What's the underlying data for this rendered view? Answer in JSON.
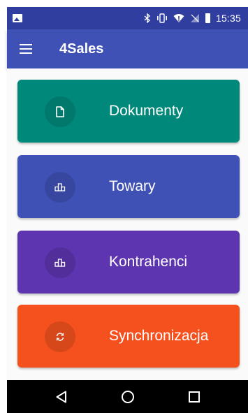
{
  "status_bar": {
    "time": "15:35",
    "icons": [
      "image-icon",
      "bluetooth-icon",
      "vibrate-icon",
      "wifi-icon",
      "no-signal-icon",
      "battery-icon"
    ]
  },
  "app_bar": {
    "title": "4Sales",
    "menu_icon": "hamburger-menu-icon"
  },
  "tiles": [
    {
      "label": "Dokumenty",
      "icon": "document-icon",
      "color": "#00897b"
    },
    {
      "label": "Towary",
      "icon": "boxes-icon",
      "color": "#3f51b5"
    },
    {
      "label": "Kontrahenci",
      "icon": "boxes-icon",
      "color": "#5e35b1"
    },
    {
      "label": "Synchronizacja",
      "icon": "sync-icon",
      "color": "#f4511e"
    }
  ],
  "nav_bar": {
    "buttons": [
      "back-icon",
      "home-icon",
      "recents-icon"
    ]
  },
  "colors": {
    "status_bar": "#303f9f",
    "app_bar": "#3f51b5",
    "nav_bar": "#000000"
  }
}
